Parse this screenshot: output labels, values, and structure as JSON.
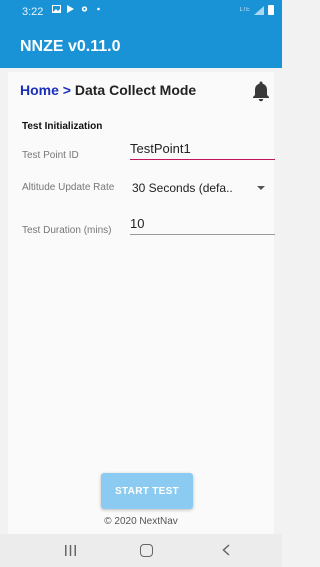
{
  "status": {
    "time": "3:22",
    "network_label": "LTE",
    "icons": [
      "gallery-icon",
      "play-store-icon",
      "settings-icon",
      "dot-icon",
      "signal-icon",
      "battery-icon"
    ]
  },
  "app": {
    "title": "NNZE v0.11.0"
  },
  "breadcrumb": {
    "home": "Home >",
    "current": "Data Collect Mode"
  },
  "section_title": "Test Initialization",
  "form": {
    "test_point_id": {
      "label": "Test Point ID",
      "value": "TestPoint1"
    },
    "altitude_rate": {
      "label": "Altitude Update Rate",
      "value": "30 Seconds (defa.."
    },
    "duration": {
      "label": "Test Duration (mins)",
      "value": "10"
    }
  },
  "start_button": "START TEST",
  "footer": "© 2020 NextNav",
  "colors": {
    "primary": "#1a93d6",
    "accent": "#c2185b",
    "link": "#1a2fb8",
    "button_disabled": "#8ccbf1"
  }
}
